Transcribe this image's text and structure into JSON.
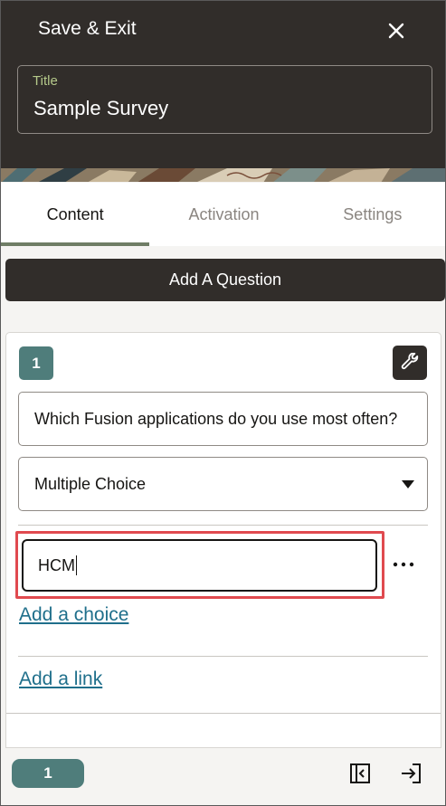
{
  "header": {
    "save_exit_label": "Save & Exit",
    "close_icon": "close-icon",
    "title_field": {
      "label": "Title",
      "value": "Sample Survey"
    }
  },
  "tabs": [
    {
      "label": "Content",
      "active": true
    },
    {
      "label": "Activation",
      "active": false
    },
    {
      "label": "Settings",
      "active": false
    }
  ],
  "add_question_label": "Add A Question",
  "question": {
    "number": "1",
    "settings_icon": "wrench-icon",
    "text": "Which Fusion applications do you use most often?",
    "type": "Multiple Choice",
    "choices": [
      {
        "value": "HCM"
      }
    ],
    "add_choice_label": "Add a choice",
    "add_link_label": "Add a link"
  },
  "footer": {
    "page_number": "1",
    "collapse_icon": "collapse-panel-icon",
    "exit_icon": "exit-icon"
  },
  "colors": {
    "header_bg": "#312d2a",
    "accent_teal": "#4f7d7b",
    "link": "#1f6f8b",
    "highlight": "#e04a4f",
    "tab_underline": "#6f7d65"
  }
}
